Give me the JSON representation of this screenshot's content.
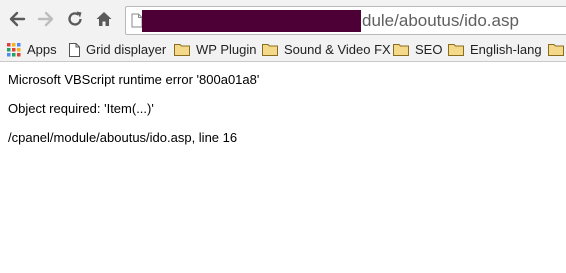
{
  "browser": {
    "url_visible_suffix": "dule/aboutus/ido.asp"
  },
  "bookmarks": [
    {
      "label": "Apps",
      "icon": "apps-grid-icon"
    },
    {
      "label": "Grid displayer",
      "icon": "page-icon"
    },
    {
      "label": "WP Plugin",
      "icon": "folder-icon"
    },
    {
      "label": "Sound & Video FX",
      "icon": "folder-icon"
    },
    {
      "label": "SEO",
      "icon": "folder-icon"
    },
    {
      "label": "English-lang",
      "icon": "folder-icon"
    },
    {
      "label": "",
      "icon": "folder-icon"
    }
  ],
  "error": {
    "title": "Microsoft VBScript runtime error '800a01a8'",
    "message": "Object required: 'Item(...)'",
    "location": "/cpanel/module/aboutus/ido.asp, line 16"
  },
  "colors": {
    "redaction": "#4c0035",
    "chrome_bar": "#f2f2f2"
  }
}
